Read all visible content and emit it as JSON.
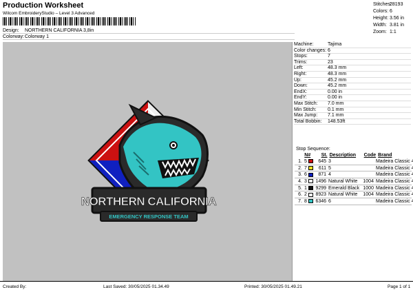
{
  "header": {
    "title": "Production Worksheet",
    "software": "Wilcom EmbroideryStudio – Level 3 Advanced"
  },
  "design": {
    "label": "Design:",
    "value": "NORTHERN CALIFORNIA 3,8in"
  },
  "colorway": {
    "label": "Colorway:",
    "value": "Colorway 1"
  },
  "stats": [
    {
      "label": "Stitches:",
      "value": "28193"
    },
    {
      "label": "Colors:",
      "value": "6"
    },
    {
      "label": "Height:",
      "value": "3.56 in"
    },
    {
      "label": "Width:",
      "value": "3.81 in"
    },
    {
      "label": "Zoom:",
      "value": "1:1"
    }
  ],
  "params": [
    {
      "label": "Machine:",
      "value": "Tajima"
    },
    {
      "label": "Color changes:",
      "value": "6"
    },
    {
      "label": "Stops:",
      "value": "7"
    },
    {
      "label": "Trims:",
      "value": "23"
    },
    {
      "label": "Left:",
      "value": "48.3 mm"
    },
    {
      "label": "Right:",
      "value": "48.3 mm"
    },
    {
      "label": "Up:",
      "value": "45.2 mm"
    },
    {
      "label": "Down:",
      "value": "45.2 mm"
    },
    {
      "label": "EndX:",
      "value": "0.00 in"
    },
    {
      "label": "EndY:",
      "value": "0.00 in"
    },
    {
      "label": "Max Stitch:",
      "value": "7.0 mm"
    },
    {
      "label": "Min Stitch:",
      "value": "0.1 mm"
    },
    {
      "label": "Max Jump:",
      "value": "7.1 mm"
    },
    {
      "label": "Total Bobbin:",
      "value": "148.53ft"
    }
  ],
  "sequence": {
    "title": "Stop Sequence:",
    "headers": {
      "num": "N#",
      "st": "St.",
      "desc": "Description",
      "code": "Code",
      "brand": "Brand"
    },
    "rows": [
      {
        "stop": "1.",
        "n": "5",
        "color": "#cc1111",
        "st": "645",
        "desc": "3",
        "code": "",
        "brand": "Madeira Classic 40"
      },
      {
        "stop": "2.",
        "n": "7",
        "color": "#f0e020",
        "st": "611",
        "desc": "5",
        "code": "",
        "brand": "Madeira Classic 40"
      },
      {
        "stop": "3.",
        "n": "6",
        "color": "#1020c0",
        "st": "871",
        "desc": "4",
        "code": "",
        "brand": "Madeira Classic 40"
      },
      {
        "stop": "4.",
        "n": "3",
        "color": "#ffffff",
        "st": "1496",
        "desc": "Natural White",
        "code": "1004",
        "brand": "Madeira Classic 40"
      },
      {
        "stop": "5.",
        "n": "1",
        "color": "#111111",
        "st": "9299",
        "desc": "Emerald Black",
        "code": "1000",
        "brand": "Madeira Classic 40"
      },
      {
        "stop": "6.",
        "n": "2",
        "color": "#ffffff",
        "st": "8923",
        "desc": "Natural White",
        "code": "1004",
        "brand": "Madeira Classic 40"
      },
      {
        "stop": "7.",
        "n": "8",
        "color": "#33c4c4",
        "st": "6346",
        "desc": "6",
        "code": "",
        "brand": "Madeira Classic 40"
      }
    ]
  },
  "artwork": {
    "title": "NORTHERN CALIFORNIA",
    "subtitle": "EMERGENCY RESPONSE TEAM"
  },
  "footer": {
    "created": "Created By:",
    "last_saved": "Last Saved: 30/05/2025 01.34.49",
    "printed": "Printed: 30/05/2025 01.49.21",
    "page": "Page 1 of 1"
  }
}
